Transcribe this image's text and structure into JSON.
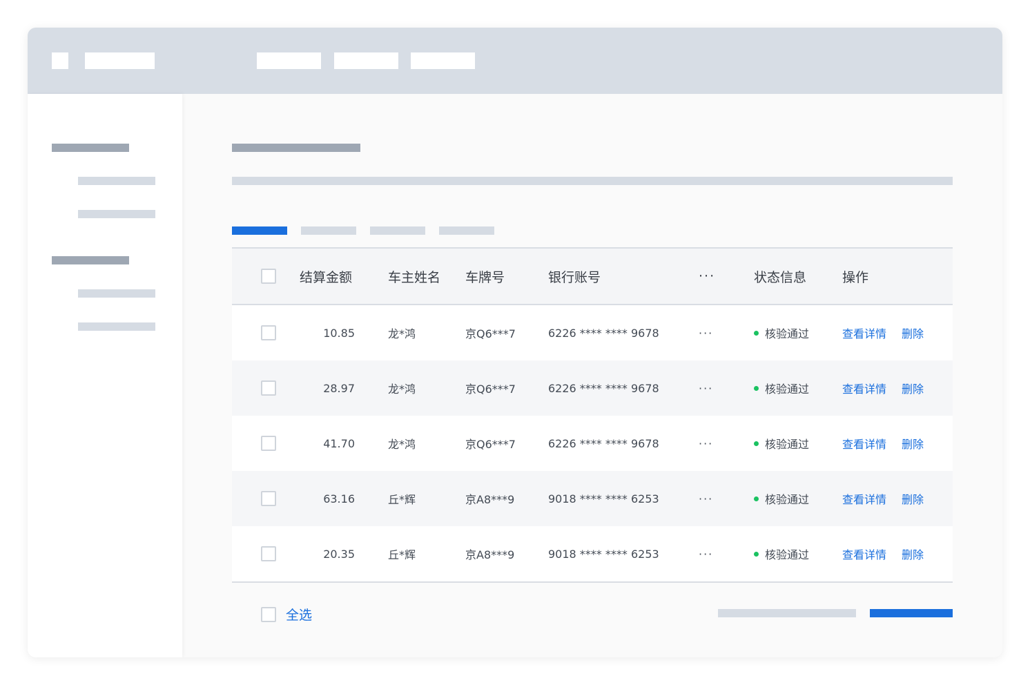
{
  "colors": {
    "topbar": "#d7dde5",
    "accent": "#1a6fdd",
    "status_ok": "#1bc261",
    "placeholder_dark": "#9ea7b3",
    "placeholder_light": "#d5dbe3"
  },
  "table": {
    "headers": {
      "amount": "结算金额",
      "owner": "车主姓名",
      "plate": "车牌号",
      "bank": "银行账号",
      "more": "···",
      "status": "状态信息",
      "ops": "操作"
    },
    "rows": [
      {
        "amount": "10.85",
        "owner": "龙*鸿",
        "plate": "京Q6***7",
        "bank": "6226 **** **** 9678",
        "more": "···",
        "status": "核验通过",
        "detail": "查看详情",
        "delete": "删除"
      },
      {
        "amount": "28.97",
        "owner": "龙*鸿",
        "plate": "京Q6***7",
        "bank": "6226 **** **** 9678",
        "more": "···",
        "status": "核验通过",
        "detail": "查看详情",
        "delete": "删除"
      },
      {
        "amount": "41.70",
        "owner": "龙*鸿",
        "plate": "京Q6***7",
        "bank": "6226 **** **** 9678",
        "more": "···",
        "status": "核验通过",
        "detail": "查看详情",
        "delete": "删除"
      },
      {
        "amount": "63.16",
        "owner": "丘*辉",
        "plate": "京A8***9",
        "bank": "9018 **** **** 6253",
        "more": "···",
        "status": "核验通过",
        "detail": "查看详情",
        "delete": "删除"
      },
      {
        "amount": "20.35",
        "owner": "丘*辉",
        "plate": "京A8***9",
        "bank": "9018 **** **** 6253",
        "more": "···",
        "status": "核验通过",
        "detail": "查看详情",
        "delete": "删除"
      }
    ]
  },
  "footer": {
    "select_all": "全选"
  }
}
